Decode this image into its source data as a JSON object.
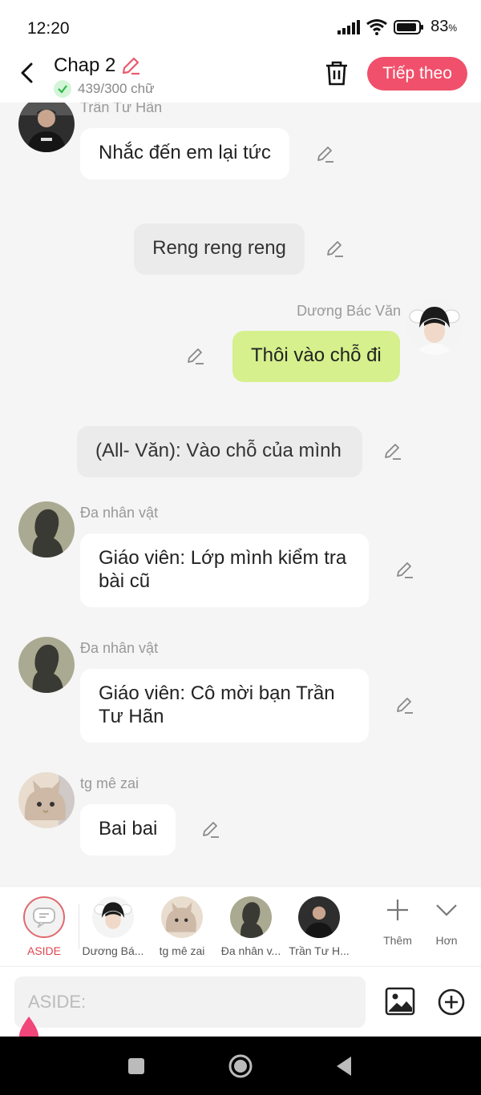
{
  "status": {
    "time": "12:20",
    "battery": "83",
    "battery_unit": "%"
  },
  "header": {
    "title": "Chap 2",
    "word_count": "439/300 chữ",
    "next_label": "Tiếp theo"
  },
  "messages": [
    {
      "name": "Trần Tư Hãn",
      "text": "Nhắc đến em lại tức"
    },
    {
      "text": "Reng reng reng"
    },
    {
      "name": "Dương Bác Văn",
      "text": "Thôi vào chỗ đi"
    },
    {
      "text": "(All- Văn): Vào chỗ của mình"
    },
    {
      "name": "Đa nhân vật",
      "line1": "Giáo viên: Lớp mình kiểm tra",
      "line2": "bài cũ"
    },
    {
      "name": "Đa nhân vật",
      "line1": "Giáo viên: Cô mời bạn Trần",
      "line2": "Tư Hãn"
    },
    {
      "name": "tg mê zai",
      "text": "Bai bai"
    }
  ],
  "tabs": [
    {
      "label": "ASIDE"
    },
    {
      "label": "Dương Bá..."
    },
    {
      "label": "tg mê zai"
    },
    {
      "label": "Đa nhân v..."
    },
    {
      "label": "Trần Tư H..."
    }
  ],
  "tools": {
    "add_label": "Thêm",
    "more_label": "Hơn"
  },
  "input": {
    "placeholder": "ASIDE:"
  },
  "colors": {
    "accent": "#f0506b",
    "green_bubble": "#d5f08d",
    "aside_active": "#e0444f"
  }
}
